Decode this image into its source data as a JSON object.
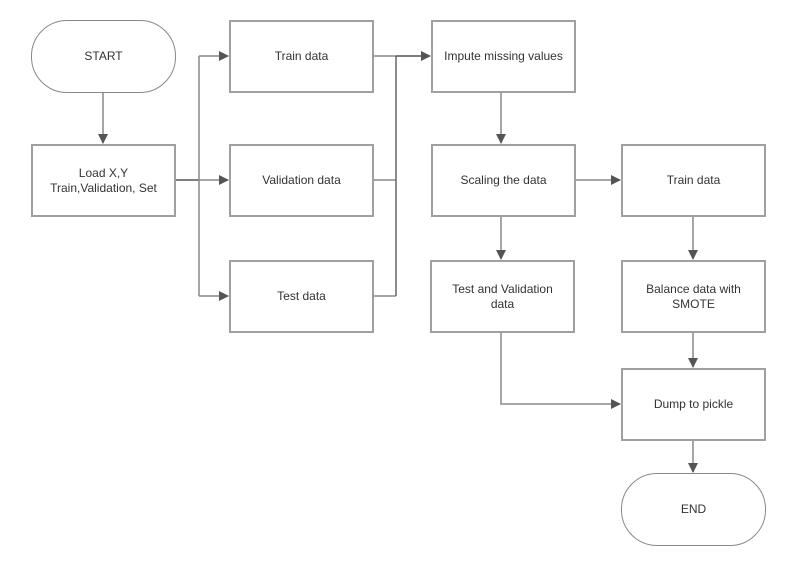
{
  "nodes": {
    "start": "START",
    "load": "Load X,Y\nTrain,Validation, Set",
    "train": "Train data",
    "validation": "Validation data",
    "test": "Test data",
    "impute": "Impute missing values",
    "scaling": "Scaling the data",
    "train_scaled": "Train data",
    "test_validation": "Test and Validation\ndata",
    "balance": "Balance data with\nSMOTE",
    "dump": "Dump to pickle",
    "end": "END"
  },
  "colors": {
    "connector": "#777777",
    "arrowhead": "#555555",
    "border": "#a0a0a0",
    "text": "#333333"
  }
}
